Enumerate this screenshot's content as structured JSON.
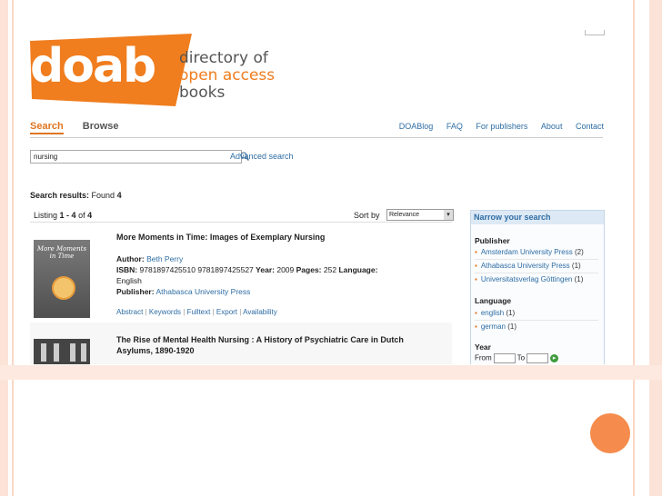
{
  "colors": {
    "brand_orange": "#f07d1e",
    "link_blue": "#2e6da4",
    "slide_accent": "#f58b4c"
  },
  "logo": {
    "wordmark": "doab",
    "tagline_1": "directory of",
    "tagline_2": "open access",
    "tagline_3": "books"
  },
  "nav": {
    "search": "Search",
    "browse": "Browse",
    "right": [
      "DOABlog",
      "FAQ",
      "For publishers",
      "About",
      "Contact"
    ]
  },
  "search": {
    "value": "nursing",
    "advanced": "Advanced search"
  },
  "results": {
    "label": "Search results:",
    "found_label": "Found",
    "found_count": "4"
  },
  "listing": {
    "prefix": "Listing",
    "range": "1 - 4",
    "of": "of",
    "total": "4",
    "sort_label": "Sort by",
    "sort_value": "Relevance"
  },
  "items": [
    {
      "title": "More Moments in Time: Images of Exemplary Nursing",
      "cover_title": "More Moments in Time",
      "author_label": "Author:",
      "author": "Beth Perry",
      "isbn_label": "ISBN:",
      "isbn": "9781897425510 9781897425527",
      "year_label": "Year:",
      "year": "2009",
      "pages_label": "Pages:",
      "pages": "252",
      "language_label": "Language:",
      "language": "English",
      "publisher_label": "Publisher:",
      "publisher": "Athabasca University Press",
      "actions": [
        "Abstract",
        "Keywords",
        "Fulltext",
        "Export",
        "Availability"
      ]
    },
    {
      "title": "The Rise of Mental Health Nursing : A History of Psychiatric Care in Dutch Asylums, 1890-1920"
    }
  ],
  "sidebar": {
    "header": "Narrow your search",
    "publisher_title": "Publisher",
    "publishers": [
      {
        "name": "Amsterdam University Press",
        "count": "(2)"
      },
      {
        "name": "Athabasca University Press",
        "count": "(1)"
      },
      {
        "name": "Universitatsverlag Göttingen",
        "count": "(1)"
      }
    ],
    "language_title": "Language",
    "languages": [
      {
        "name": "english",
        "count": "(1)"
      },
      {
        "name": "german",
        "count": "(1)"
      }
    ],
    "year_title": "Year",
    "from_label": "From",
    "to_label": "To"
  }
}
